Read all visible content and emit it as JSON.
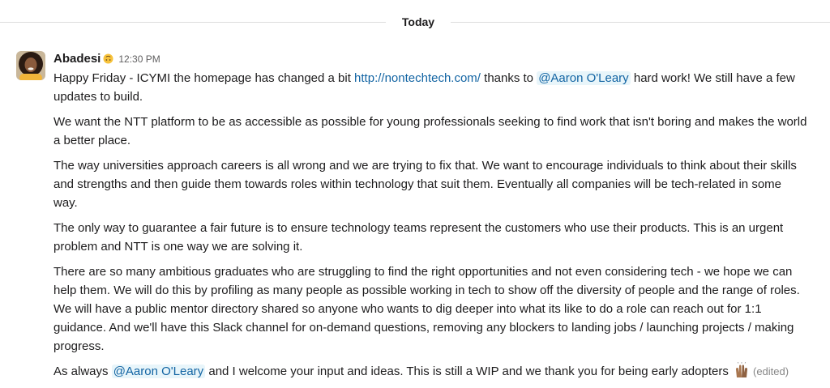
{
  "divider": {
    "label": "Today"
  },
  "message": {
    "sender": "Abadesi",
    "status_emoji": "upside-down-face-emoji",
    "time": "12:30 PM",
    "p1": {
      "a": "Happy Friday - ICYMI the homepage has changed a bit ",
      "link": "http://nontechtech.com/",
      "b": " thanks to ",
      "mention": "@Aaron O'Leary",
      "c": " hard work! We still have a few\nupdates to build."
    },
    "p2": "We want the NTT platform to be as accessible as possible for young professionals seeking to find work that isn't boring and makes the world\na better place.",
    "p3": "The way universities approach careers is all wrong and we are trying to fix that. We want to encourage individuals to think about their skills\nand strengths and then guide them towards roles within technology that suit them. Eventually all companies will be tech-related in some\nway.",
    "p4": "The only way to guarantee a fair future is to ensure technology teams represent the customers who use their products. This is an urgent\nproblem and NTT is one way we are solving it.",
    "p5": "There are so many ambitious graduates who are struggling to find the right opportunities and not even considering tech - we hope we can\nhelp them. We will do this by profiling as many people as possible working in tech to show off the diversity of people and the range of roles.\nWe will have a public mentor directory shared so anyone who wants to dig deeper into what its like to do a role can reach out for 1:1\nguidance. And we'll have this Slack channel for on-demand questions, removing any blockers to landing jobs / launching projects / making\nprogress.",
    "p6": {
      "a": "As always ",
      "mention": "@Aaron O'Leary",
      "b": " and I welcome your input and ideas. This is still a WIP and we thank you for being early adopters ",
      "emoji": "raised-hands-emoji",
      "edited": "(edited)"
    }
  },
  "colors": {
    "link": "#1264a3",
    "mention_bg": "#e8f5fa",
    "text": "#1d1c1d",
    "muted": "#616061"
  }
}
